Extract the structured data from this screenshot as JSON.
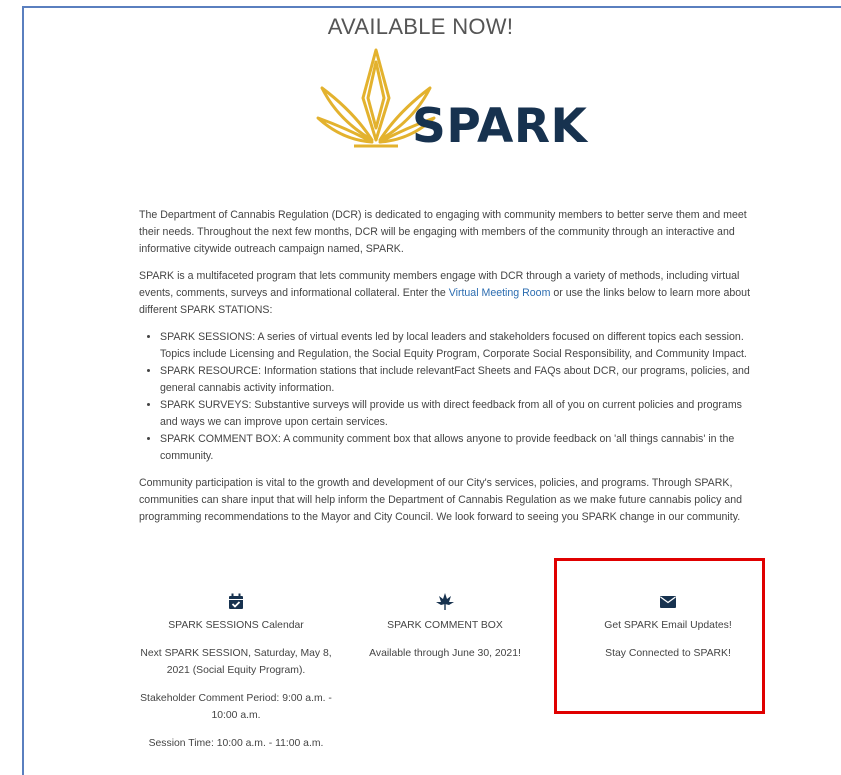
{
  "header": {
    "title": "AVAILABLE NOW!",
    "logo_text": "SPARK"
  },
  "intro": {
    "p1": "The Department of Cannabis Regulation (DCR) is dedicated to engaging with community members to better serve them and meet their needs. Throughout the next few months, DCR will be engaging with members of the community through an interactive and informative citywide outreach campaign named, SPARK.",
    "p2_before": "SPARK is a multifaceted program that lets community members engage with DCR through a variety of methods, including virtual events, comments, surveys and informational collateral. Enter the ",
    "p2_link": "Virtual Meeting Room",
    "p2_after": " or use the links below to learn more about different SPARK STATIONS:"
  },
  "stations": [
    "SPARK SESSIONS: A series of virtual events led by local leaders and stakeholders focused on different topics each session. Topics include Licensing and Regulation, the Social Equity Program, Corporate Social Responsibility, and Community Impact.",
    "SPARK RESOURCE: Information stations that include relevantFact Sheets and FAQs about DCR, our programs, policies, and general cannabis activity information.",
    "SPARK SURVEYS: Substantive surveys will provide us with direct feedback from all of you on current policies and programs and ways we can improve upon certain services.",
    "SPARK COMMENT BOX: A community comment box that allows anyone to provide feedback on 'all things cannabis' in the community."
  ],
  "closing": "Community participation is vital to the growth and development of our City's services, policies, and programs. Through SPARK, communities can share input that will help inform the Department of Cannabis Regulation as we make future cannabis policy and programming recommendations to the Mayor and City Council. We look forward to seeing you SPARK change in our community.",
  "columns": {
    "calendar": {
      "icon": "calendar-check-icon",
      "title": "SPARK SESSIONS Calendar",
      "next": "Next SPARK SESSION, Saturday, May 8, 2021 (Social Equity Program).",
      "stakeholder": "Stakeholder Comment Period: 9:00 a.m. - 10:00 a.m.",
      "session": "Session Time: 10:00 a.m. - 11:00 a.m."
    },
    "comment_box": {
      "icon": "cannabis-leaf-icon",
      "title": "SPARK COMMENT BOX",
      "availability": "Available through June 30, 2021!"
    },
    "email": {
      "icon": "envelope-icon",
      "title": "Get SPARK Email Updates!",
      "subtitle": "Stay Connected to SPARK!"
    }
  },
  "colors": {
    "brand_navy": "#17324f",
    "logo_gold": "#e3b22e",
    "link_blue": "#2b6cb0",
    "highlight_red": "#e00000"
  }
}
